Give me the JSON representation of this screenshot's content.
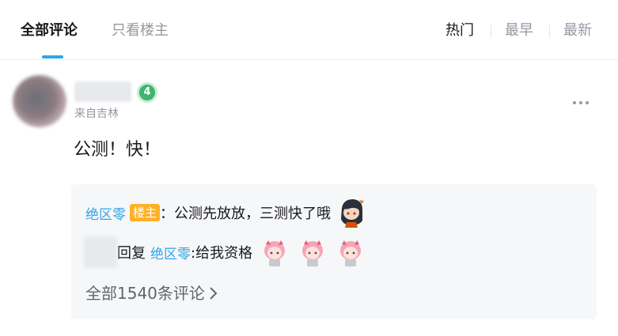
{
  "tabs": {
    "all": "全部评论",
    "owner_only": "只看楼主"
  },
  "sort": {
    "hot": "热门",
    "earliest": "最早",
    "latest": "最新"
  },
  "comment": {
    "level": "4",
    "location": "来自吉林",
    "text": "公测！快！"
  },
  "replies": {
    "first": {
      "user": "绝区零",
      "owner_tag": "楼主",
      "text": "：公测先放放，三测快了哦"
    },
    "second": {
      "reply_word": "回复",
      "target_user": "绝区零",
      "text": ":给我资格"
    },
    "view_all": "全部1540条评论"
  },
  "colors": {
    "accent": "#2fa6e8",
    "owner_tag": "#ffb027",
    "level_badge": "#3fb56e"
  },
  "icons": {
    "more": "more-dots-icon",
    "chevron": "chevron-right-icon",
    "level": "level-4-icon"
  }
}
